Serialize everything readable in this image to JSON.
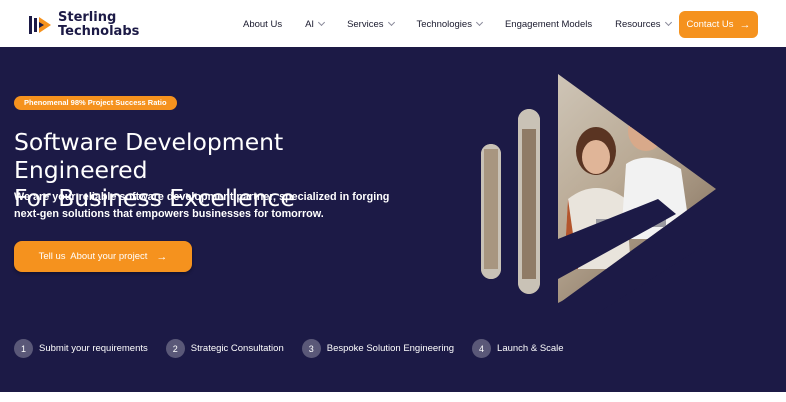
{
  "brand": {
    "name_line1": "Sterling",
    "name_line2": "Technolabs",
    "logo_icon": "play-stripes-logo"
  },
  "nav": {
    "items": [
      {
        "label": "About Us",
        "has_dropdown": false
      },
      {
        "label": "AI",
        "has_dropdown": true
      },
      {
        "label": "Services",
        "has_dropdown": true
      },
      {
        "label": "Technologies",
        "has_dropdown": true
      },
      {
        "label": "Engagement Models",
        "has_dropdown": false
      },
      {
        "label": "Resources",
        "has_dropdown": true
      }
    ],
    "contact_label": "Contact Us",
    "contact_icon": "arrow-right-icon"
  },
  "hero": {
    "badge": "Phenomenal 98% Project Success Ratio",
    "title_line1": "Software Development Engineered",
    "title_line2": "For Business Excellence",
    "subtitle": "We are your reliable software development partner, specialized in forging next-gen solutions that empowers businesses for tomorrow.",
    "cta_label": "Tell us  About your project",
    "cta_icon": "arrow-right-icon",
    "image_icon": "team-photo-play-shape"
  },
  "steps": [
    {
      "num": "1",
      "label": "Submit your requirements"
    },
    {
      "num": "2",
      "label": "Strategic Consultation"
    },
    {
      "num": "3",
      "label": "Bespoke Solution Engineering"
    },
    {
      "num": "4",
      "label": "Launch & Scale"
    }
  ],
  "colors": {
    "accent": "#f5921e",
    "hero_bg": "#1c1a46",
    "brand_text": "#1c1a46",
    "step_circle": "#5a5878"
  }
}
